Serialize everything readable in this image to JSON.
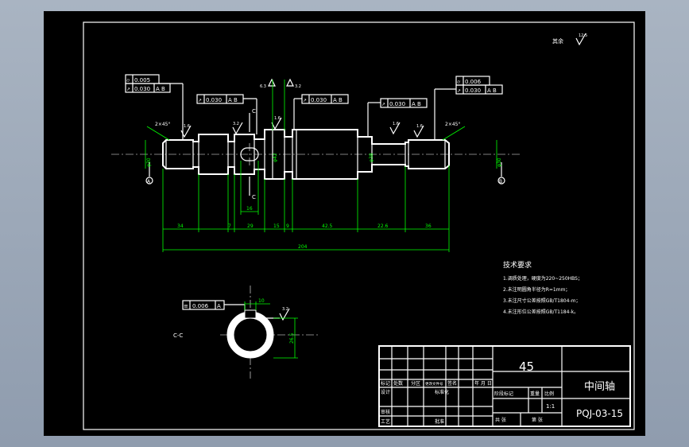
{
  "sheet": {
    "roughness_other": "其余",
    "roughness_other_value": "12.5"
  },
  "shaft": {
    "tolerances": {
      "left_runout_1": "0.005",
      "left_runout_2": "0.030",
      "left_datum_ab": "A B",
      "left_runout_mid": "0.030",
      "mid_datum_ab": "A B",
      "center_runout": "0.030",
      "center_datum_ab": "A B",
      "right_runout_mid": "0.030",
      "right_mid_datum_ab": "A B",
      "right_runout_1": "0.006",
      "right_runout_2": "0.030",
      "right_datum_ab": "A B"
    },
    "chamfer_left": "2×45°",
    "chamfer_right": "2×45°",
    "roughness": [
      "1.6",
      "3.2",
      "1.6",
      "1.6",
      "1.6",
      "6.3",
      "3.2"
    ],
    "section_mark": "C",
    "datum_a": "A",
    "datum_b": "B",
    "dims": {
      "d1": "34",
      "d2": "7",
      "d3": "29",
      "d4": "15",
      "d5": "9",
      "d6": "42.5",
      "d7": "22.6",
      "d8": "36",
      "keyway_len": "16",
      "total": "204"
    },
    "diameters": {
      "left_journal": "φ30",
      "center": "φ42",
      "right_step": "φ38",
      "right_journal": "φ30"
    }
  },
  "section": {
    "label": "C-C",
    "tolerance_value": "0.006",
    "tolerance_datum": "A",
    "key_width": "10",
    "roughness": "3.2",
    "depth_dim": "26.5"
  },
  "notes": {
    "heading": "技术要求",
    "items": [
      "1.调质处理，硬度为220~250HBS；",
      "2.未注明圆角半径为R=1mm；",
      "3.未注尺寸公差按照GB/T1804-m；",
      "4.未注形位公差按照GB/T1184-k。"
    ]
  },
  "title_block": {
    "material": "45",
    "part_name": "中间轴",
    "drawing_no": "PQJ-03-15",
    "scale": "1:1",
    "headers": [
      "标记",
      "处数",
      "分区",
      "更改文件号",
      "签名",
      "年 月 日"
    ],
    "stage_mark": "阶段标记",
    "weight": "重量",
    "ratio": "比例",
    "design": "设计",
    "standardization": "标准化",
    "review": "审核",
    "process": "工艺",
    "approval": "批准",
    "total_sheets": "共 张",
    "sheet_no": "第 张"
  }
}
